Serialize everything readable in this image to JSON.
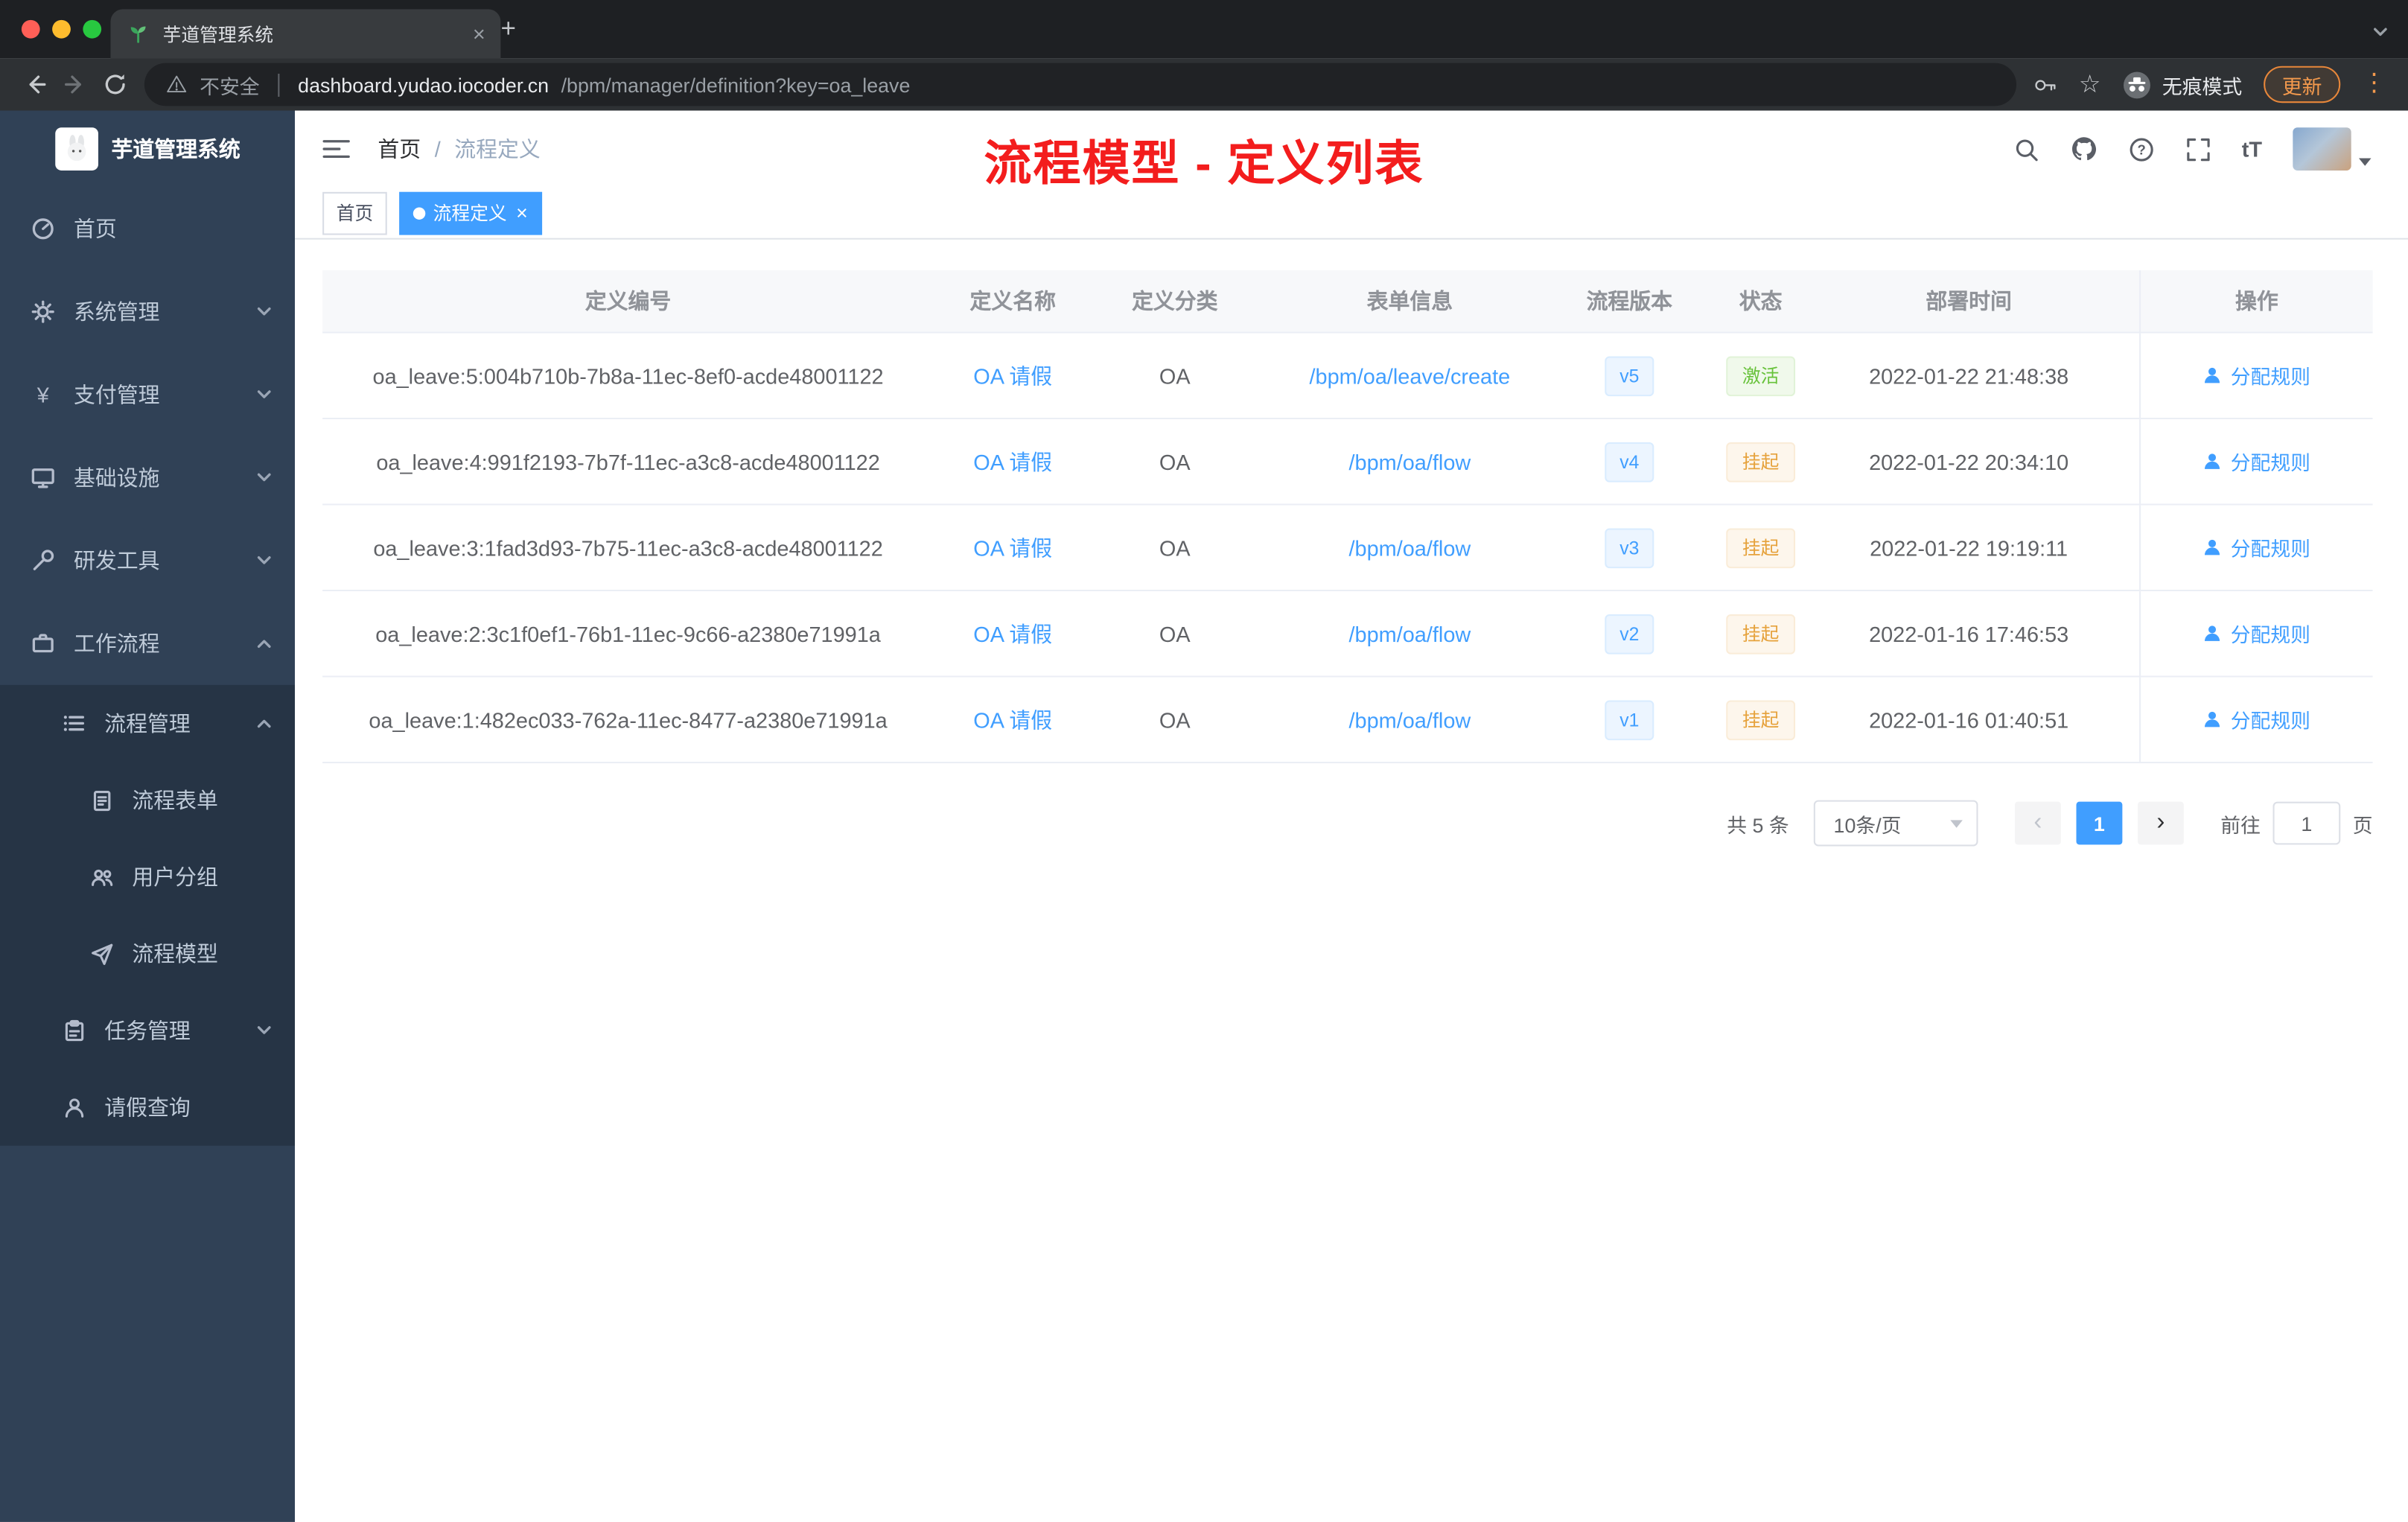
{
  "browser": {
    "tab_title": "芋道管理系统",
    "security_label": "不安全",
    "url_host": "dashboard.yudao.iocoder.cn",
    "url_path": "/bpm/manager/definition?key=oa_leave",
    "incognito_label": "无痕模式",
    "update_label": "更新"
  },
  "header": {
    "breadcrumb": [
      "首页",
      "流程定义"
    ],
    "breadcrumb_separator": "/",
    "annotation": "流程模型 - 定义列表"
  },
  "tags": [
    {
      "label": "首页",
      "active": false
    },
    {
      "label": "流程定义",
      "active": true
    }
  ],
  "sidebar": {
    "logo_title": "芋道管理系统",
    "menu": [
      {
        "label": "首页"
      },
      {
        "label": "系统管理"
      },
      {
        "label": "支付管理"
      },
      {
        "label": "基础设施"
      },
      {
        "label": "研发工具"
      },
      {
        "label": "工作流程"
      }
    ],
    "submenu": {
      "process": {
        "label": "流程管理"
      },
      "process_children": [
        {
          "label": "流程表单"
        },
        {
          "label": "用户分组"
        },
        {
          "label": "流程模型"
        }
      ],
      "task": {
        "label": "任务管理"
      },
      "leave": {
        "label": "请假查询"
      }
    }
  },
  "table": {
    "columns": [
      "定义编号",
      "定义名称",
      "定义分类",
      "表单信息",
      "流程版本",
      "状态",
      "部署时间",
      "操作"
    ],
    "rows": [
      {
        "id": "oa_leave:5:004b710b-7b8a-11ec-8ef0-acde48001122",
        "name": "OA 请假",
        "category": "OA",
        "form": "/bpm/oa/leave/create",
        "version": "v5",
        "status": "激活",
        "status_type": "success",
        "time": "2022-01-22 21:48:38",
        "action": "分配规则"
      },
      {
        "id": "oa_leave:4:991f2193-7b7f-11ec-a3c8-acde48001122",
        "name": "OA 请假",
        "category": "OA",
        "form": "/bpm/oa/flow",
        "version": "v4",
        "status": "挂起",
        "status_type": "warning",
        "time": "2022-01-22 20:34:10",
        "action": "分配规则"
      },
      {
        "id": "oa_leave:3:1fad3d93-7b75-11ec-a3c8-acde48001122",
        "name": "OA 请假",
        "category": "OA",
        "form": "/bpm/oa/flow",
        "version": "v3",
        "status": "挂起",
        "status_type": "warning",
        "time": "2022-01-22 19:19:11",
        "action": "分配规则"
      },
      {
        "id": "oa_leave:2:3c1f0ef1-76b1-11ec-9c66-a2380e71991a",
        "name": "OA 请假",
        "category": "OA",
        "form": "/bpm/oa/flow",
        "version": "v2",
        "status": "挂起",
        "status_type": "warning",
        "time": "2022-01-16 17:46:53",
        "action": "分配规则"
      },
      {
        "id": "oa_leave:1:482ec033-762a-11ec-8477-a2380e71991a",
        "name": "OA 请假",
        "category": "OA",
        "form": "/bpm/oa/flow",
        "version": "v1",
        "status": "挂起",
        "status_type": "warning",
        "time": "2022-01-16 01:40:51",
        "action": "分配规则"
      }
    ]
  },
  "pagination": {
    "total": "共 5 条",
    "page_size": "10条/页",
    "current_page": "1",
    "goto_label": "前往",
    "goto_value": "1",
    "unit_label": "页"
  },
  "icons": {
    "star": "☆",
    "more_vert": "⋮",
    "close": "×",
    "yen": "¥",
    "font_size": "tT",
    "prev": "‹",
    "next": "›",
    "plus": "+"
  },
  "colors": {
    "accent": "#409eff",
    "success": "#67c23a",
    "warning": "#e6a23c",
    "annotation_red": "#f31d1d",
    "sidebar_bg": "#304156",
    "submenu_bg": "#263445"
  }
}
